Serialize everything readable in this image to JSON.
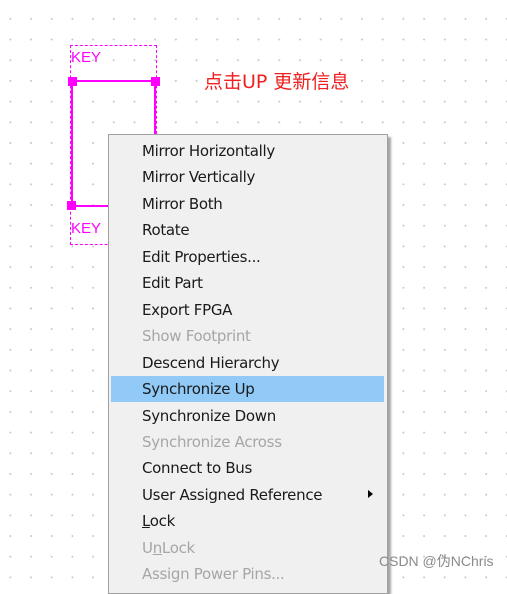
{
  "schematic": {
    "part_label_top": "KEY",
    "part_label_bottom": "KEY",
    "color": "#ff00ff"
  },
  "annotation": {
    "text": "点击UP 更新信息",
    "color": "#f02020"
  },
  "context_menu": {
    "items": [
      {
        "label": "Mirror Horizontally",
        "enabled": true
      },
      {
        "label": "Mirror Vertically",
        "enabled": true
      },
      {
        "label": "Mirror Both",
        "enabled": true
      },
      {
        "label": "Rotate",
        "enabled": true
      },
      {
        "label": "Edit Properties...",
        "enabled": true
      },
      {
        "label": "Edit Part",
        "enabled": true
      },
      {
        "label": "Export FPGA",
        "enabled": true
      },
      {
        "label": "Show Footprint",
        "enabled": false
      },
      {
        "label": "Descend Hierarchy",
        "enabled": true
      },
      {
        "label": "Synchronize Up",
        "enabled": true,
        "highlighted": true
      },
      {
        "label": "Synchronize Down",
        "enabled": true
      },
      {
        "label": "Synchronize Across",
        "enabled": false
      },
      {
        "label": "Connect to Bus",
        "enabled": true
      },
      {
        "label": "User Assigned Reference",
        "enabled": true,
        "submenu": true
      },
      {
        "label": "Lock",
        "enabled": true,
        "mnemonic": "L"
      },
      {
        "label": "UnLock",
        "enabled": false,
        "mnemonic": "n"
      },
      {
        "label": "Assign Power Pins...",
        "enabled": false
      }
    ],
    "highlight_color": "#91c9f7"
  },
  "watermark": "CSDN @伪NChris"
}
